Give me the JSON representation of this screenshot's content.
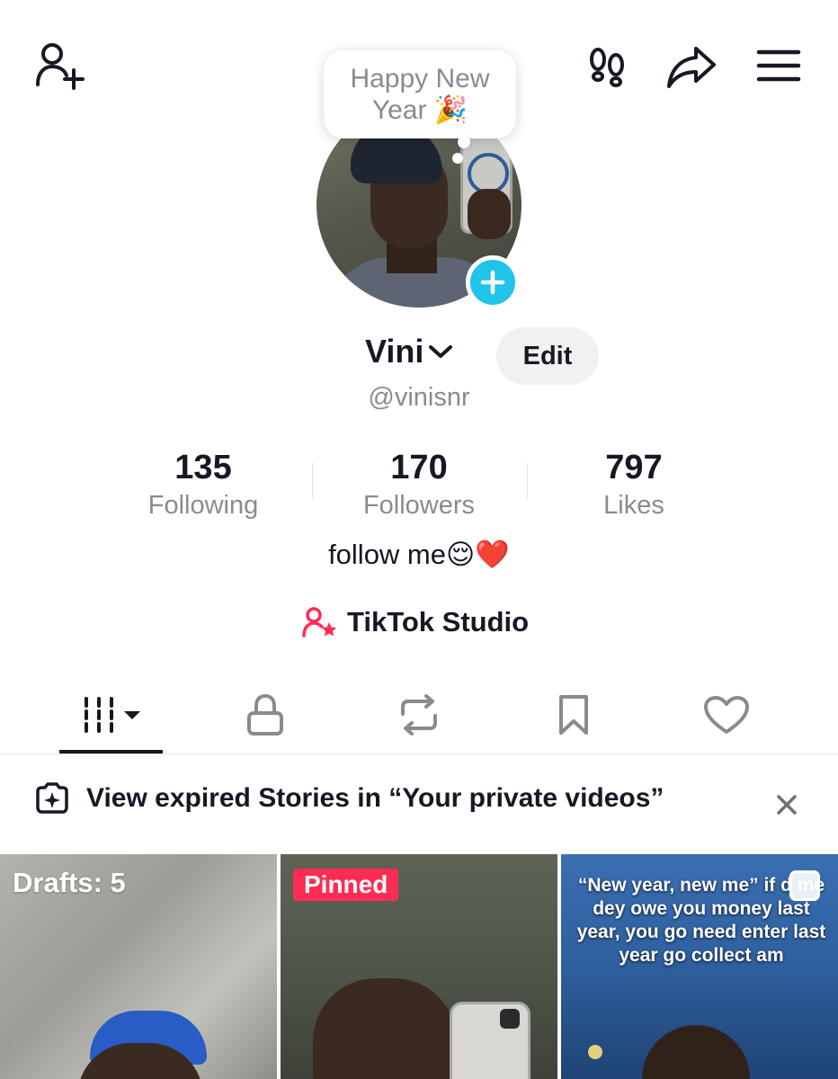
{
  "header": {
    "add_friend_icon": "person-plus-icon",
    "footprints_icon": "footprints-icon",
    "share_icon": "share-arrow-icon",
    "menu_icon": "hamburger-menu-icon"
  },
  "note": {
    "line1": "Happy New",
    "line2": "Year 🎉"
  },
  "profile": {
    "name": "Vini",
    "handle": "@vinisnr",
    "edit_label": "Edit",
    "bio": "follow me😌❤️",
    "studio_label": "TikTok Studio"
  },
  "stats": [
    {
      "value": "135",
      "label": "Following"
    },
    {
      "value": "170",
      "label": "Followers"
    },
    {
      "value": "797",
      "label": "Likes"
    }
  ],
  "tabs": [
    {
      "icon": "videos-grid-icon",
      "active": true
    },
    {
      "icon": "lock-icon"
    },
    {
      "icon": "repost-icon"
    },
    {
      "icon": "bookmark-icon"
    },
    {
      "icon": "heart-icon"
    }
  ],
  "notice": {
    "text": "View expired Stories in “Your private videos”"
  },
  "grid": {
    "tile1_label": "Drafts: 5",
    "tile2_badge": "Pinned",
    "tile3_caption": "“New year, new me” if d me dey owe you money last year, you go need enter last year go collect am"
  },
  "colors": {
    "accent_pink": "#fe2c55",
    "plus_blue": "#20c3e9",
    "text_primary": "#161823",
    "text_secondary": "#8a8b91"
  }
}
